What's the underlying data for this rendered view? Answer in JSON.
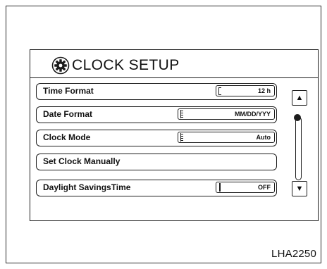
{
  "screen": {
    "title": "CLOCK SETUP",
    "title_icon": "gear-icon",
    "menu": [
      {
        "label": "Time Format",
        "value": "12 h",
        "indicator": "bracket"
      },
      {
        "label": "Date Format",
        "value": "MM/DD/YYY",
        "indicator": "ticks"
      },
      {
        "label": "Clock Mode",
        "value": "Auto",
        "indicator": "ticks"
      },
      {
        "label": "Set Clock Manually"
      },
      {
        "label": "Daylight SavingsTime",
        "value": "OFF",
        "indicator": "bar"
      }
    ],
    "scroll": {
      "up_icon": "up-arrow-icon",
      "down_icon": "down-arrow-icon",
      "up_glyph": "▲",
      "down_glyph": "▼",
      "position": 0
    }
  },
  "figure_code": "LHA2250"
}
